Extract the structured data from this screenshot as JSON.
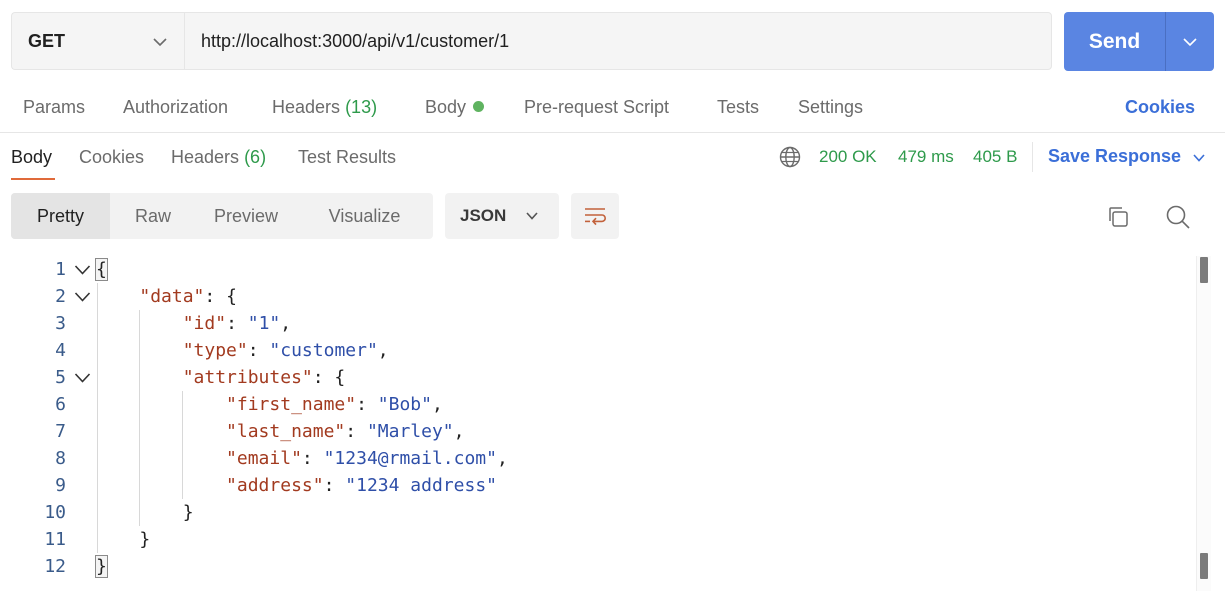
{
  "request": {
    "method": "GET",
    "url": "http://localhost:3000/api/v1/customer/1",
    "send_label": "Send"
  },
  "request_tabs": [
    {
      "label": "Params"
    },
    {
      "label": "Authorization"
    },
    {
      "label": "Headers",
      "count": "(13)"
    },
    {
      "label": "Body"
    },
    {
      "label": "Pre-request Script"
    },
    {
      "label": "Tests"
    },
    {
      "label": "Settings"
    }
  ],
  "cookies_link": "Cookies",
  "response_tabs": [
    {
      "label": "Body"
    },
    {
      "label": "Cookies"
    },
    {
      "label": "Headers",
      "count": "(6)"
    },
    {
      "label": "Test Results"
    }
  ],
  "response_status": {
    "status": "200 OK",
    "time": "479 ms",
    "size": "405 B",
    "save_label": "Save Response"
  },
  "view_modes": [
    "Pretty",
    "Raw",
    "Preview",
    "Visualize"
  ],
  "format": "JSON",
  "colors": {
    "accent": "#5a85e2",
    "link": "#3b6fd8",
    "success": "#2e9a4b",
    "tab_indicator": "#e06a3a"
  },
  "line_numbers": [
    "1",
    "2",
    "3",
    "4",
    "5",
    "6",
    "7",
    "8",
    "9",
    "10",
    "11",
    "12"
  ],
  "code_lines": [
    [
      {
        "t": "{",
        "c": "p"
      }
    ],
    [
      {
        "t": "    "
      },
      {
        "t": "\"data\"",
        "c": "k"
      },
      {
        "t": ": {",
        "c": "p"
      }
    ],
    [
      {
        "t": "        "
      },
      {
        "t": "\"id\"",
        "c": "k"
      },
      {
        "t": ": ",
        "c": "p"
      },
      {
        "t": "\"1\"",
        "c": "s"
      },
      {
        "t": ",",
        "c": "p"
      }
    ],
    [
      {
        "t": "        "
      },
      {
        "t": "\"type\"",
        "c": "k"
      },
      {
        "t": ": ",
        "c": "p"
      },
      {
        "t": "\"customer\"",
        "c": "s"
      },
      {
        "t": ",",
        "c": "p"
      }
    ],
    [
      {
        "t": "        "
      },
      {
        "t": "\"attributes\"",
        "c": "k"
      },
      {
        "t": ": {",
        "c": "p"
      }
    ],
    [
      {
        "t": "            "
      },
      {
        "t": "\"first_name\"",
        "c": "k"
      },
      {
        "t": ": ",
        "c": "p"
      },
      {
        "t": "\"Bob\"",
        "c": "s"
      },
      {
        "t": ",",
        "c": "p"
      }
    ],
    [
      {
        "t": "            "
      },
      {
        "t": "\"last_name\"",
        "c": "k"
      },
      {
        "t": ": ",
        "c": "p"
      },
      {
        "t": "\"Marley\"",
        "c": "s"
      },
      {
        "t": ",",
        "c": "p"
      }
    ],
    [
      {
        "t": "            "
      },
      {
        "t": "\"email\"",
        "c": "k"
      },
      {
        "t": ": ",
        "c": "p"
      },
      {
        "t": "\"1234@rmail.com\"",
        "c": "s"
      },
      {
        "t": ",",
        "c": "p"
      }
    ],
    [
      {
        "t": "            "
      },
      {
        "t": "\"address\"",
        "c": "k"
      },
      {
        "t": ": ",
        "c": "p"
      },
      {
        "t": "\"1234 address\"",
        "c": "s"
      }
    ],
    [
      {
        "t": "        "
      },
      {
        "t": "}",
        "c": "p"
      }
    ],
    [
      {
        "t": "    "
      },
      {
        "t": "}",
        "c": "p"
      }
    ],
    [
      {
        "t": "}",
        "c": "p"
      }
    ]
  ],
  "icons": {
    "method_dropdown": "chevron-down-icon",
    "send_more": "chevron-down-icon",
    "globe": "globe-icon",
    "wrap": "wrap-lines-icon",
    "copy": "copy-icon",
    "search": "search-icon"
  }
}
